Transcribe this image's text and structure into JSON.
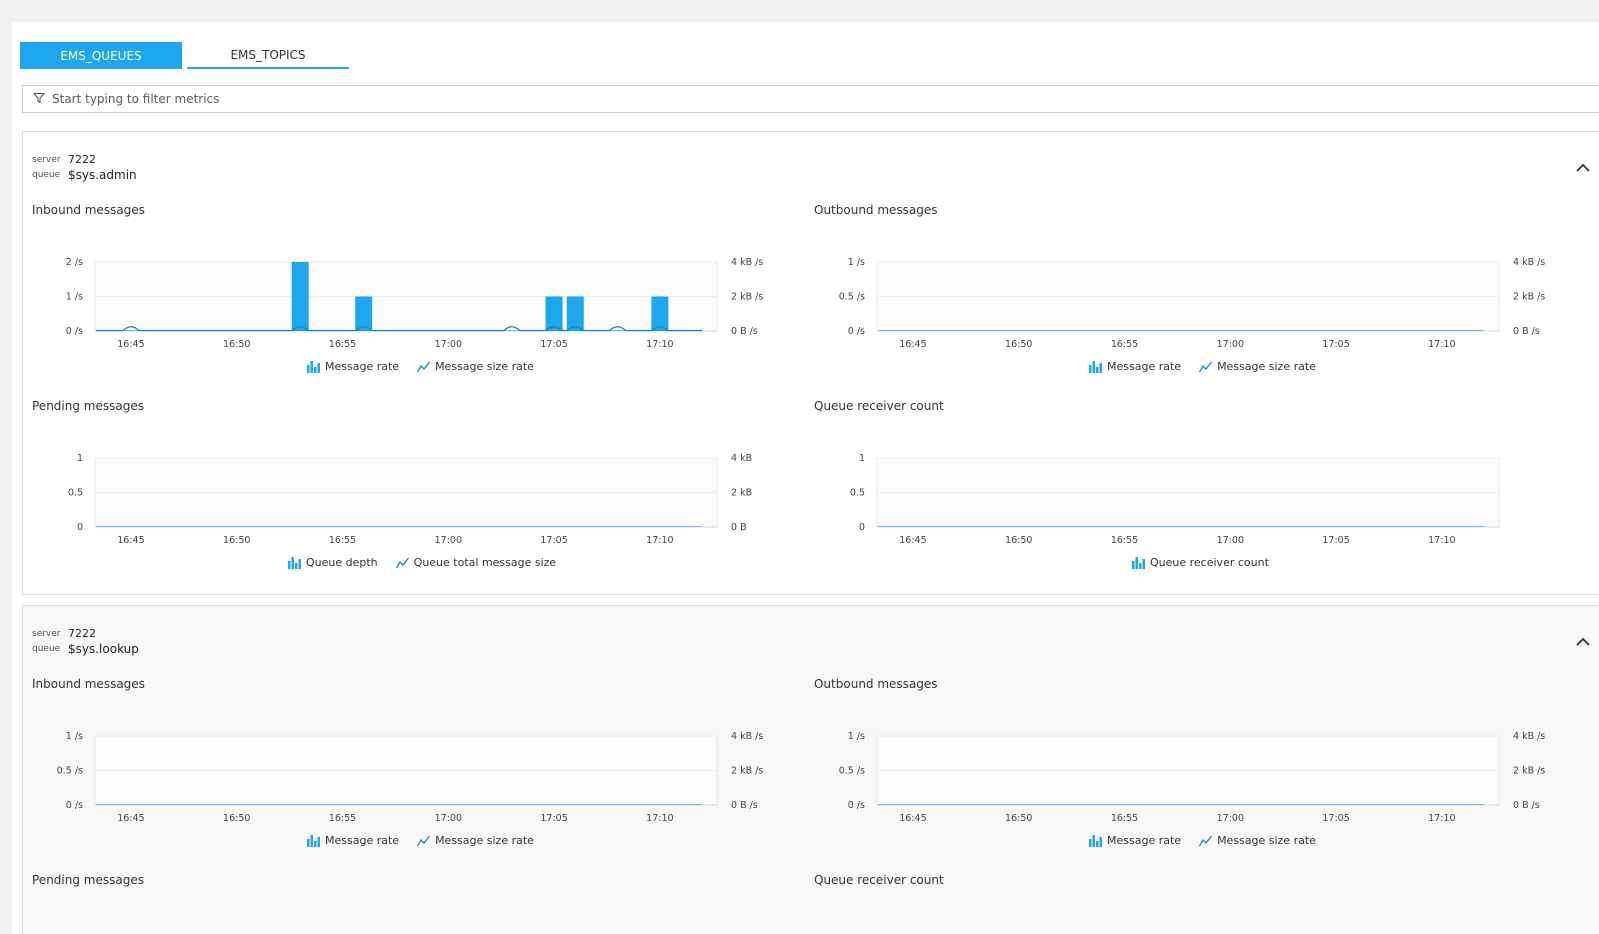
{
  "tabs": [
    {
      "label": "EMS_QUEUES",
      "active": true
    },
    {
      "label": "EMS_TOPICS",
      "active": false
    }
  ],
  "filter": {
    "placeholder": "Start typing to filter metrics",
    "icon": "filter-icon"
  },
  "accent_color": "#1ea7ef",
  "cards": [
    {
      "server_label": "server",
      "server_value": "7222",
      "queue_label": "queue",
      "queue_value": "$sys.admin",
      "collapse_icon": "chevron-up-icon",
      "charts": [
        {
          "title": "Inbound messages",
          "left_ticks": [
            "2 /s",
            "1 /s",
            "0 /s"
          ],
          "right_ticks": [
            "4 kB /s",
            "2 kB /s",
            "0 B /s"
          ],
          "x_ticks": [
            "16:45",
            "16:50",
            "16:55",
            "17:00",
            "17:05",
            "17:10"
          ],
          "legend": [
            {
              "icon": "bar-chart-icon",
              "label": "Message rate"
            },
            {
              "icon": "line-chart-icon",
              "label": "Message size rate"
            }
          ],
          "chart_data": {
            "type": "bar",
            "x": [
              "16:53",
              "16:56",
              "17:05",
              "17:06",
              "17:10"
            ],
            "series": [
              {
                "name": "Message rate",
                "values": [
                  2,
                  1,
                  1,
                  1,
                  1
                ]
              }
            ],
            "ylim": [
              0,
              2
            ]
          }
        },
        {
          "title": "Outbound messages",
          "left_ticks": [
            "1 /s",
            "0.5 /s",
            "0 /s"
          ],
          "right_ticks": [
            "4 kB /s",
            "2 kB /s",
            "0 B /s"
          ],
          "x_ticks": [
            "16:45",
            "16:50",
            "16:55",
            "17:00",
            "17:05",
            "17:10"
          ],
          "legend": [
            {
              "icon": "bar-chart-icon",
              "label": "Message rate"
            },
            {
              "icon": "line-chart-icon",
              "label": "Message size rate"
            }
          ],
          "chart_data": {
            "type": "bar",
            "series": [
              {
                "name": "Message rate",
                "values": []
              }
            ],
            "ylim": [
              0,
              1
            ]
          }
        },
        {
          "title": "Pending messages",
          "left_ticks": [
            "1",
            "0.5",
            "0"
          ],
          "right_ticks": [
            "4 kB",
            "2 kB",
            "0 B"
          ],
          "x_ticks": [
            "16:45",
            "16:50",
            "16:55",
            "17:00",
            "17:05",
            "17:10"
          ],
          "legend": [
            {
              "icon": "bar-chart-icon",
              "label": "Queue depth"
            },
            {
              "icon": "line-chart-icon",
              "label": "Queue total message size"
            }
          ],
          "chart_data": {
            "type": "bar",
            "series": [
              {
                "name": "Queue depth",
                "values": []
              }
            ],
            "ylim": [
              0,
              1
            ]
          }
        },
        {
          "title": "Queue receiver count",
          "left_ticks": [
            "1",
            "0.5",
            "0"
          ],
          "right_ticks": [],
          "x_ticks": [
            "16:45",
            "16:50",
            "16:55",
            "17:00",
            "17:05",
            "17:10"
          ],
          "legend": [
            {
              "icon": "bar-chart-icon",
              "label": "Queue receiver count"
            }
          ],
          "chart_data": {
            "type": "bar",
            "series": [
              {
                "name": "Queue receiver count",
                "values": []
              }
            ],
            "ylim": [
              0,
              1
            ]
          }
        }
      ]
    },
    {
      "server_label": "server",
      "server_value": "7222",
      "queue_label": "queue",
      "queue_value": "$sys.lookup",
      "collapse_icon": "chevron-up-icon",
      "charts": [
        {
          "title": "Inbound messages",
          "left_ticks": [
            "1 /s",
            "0.5 /s",
            "0 /s"
          ],
          "right_ticks": [
            "4 kB /s",
            "2 kB /s",
            "0 B /s"
          ],
          "x_ticks": [
            "16:45",
            "16:50",
            "16:55",
            "17:00",
            "17:05",
            "17:10"
          ],
          "legend": [
            {
              "icon": "bar-chart-icon",
              "label": "Message rate"
            },
            {
              "icon": "line-chart-icon",
              "label": "Message size rate"
            }
          ],
          "chart_data": {
            "type": "bar",
            "series": [
              {
                "name": "Message rate",
                "values": []
              }
            ],
            "ylim": [
              0,
              1
            ]
          }
        },
        {
          "title": "Outbound messages",
          "left_ticks": [
            "1 /s",
            "0.5 /s",
            "0 /s"
          ],
          "right_ticks": [
            "4 kB /s",
            "2 kB /s",
            "0 B /s"
          ],
          "x_ticks": [
            "16:45",
            "16:50",
            "16:55",
            "17:00",
            "17:05",
            "17:10"
          ],
          "legend": [
            {
              "icon": "bar-chart-icon",
              "label": "Message rate"
            },
            {
              "icon": "line-chart-icon",
              "label": "Message size rate"
            }
          ],
          "chart_data": {
            "type": "bar",
            "series": [
              {
                "name": "Message rate",
                "values": []
              }
            ],
            "ylim": [
              0,
              1
            ]
          }
        },
        {
          "title": "Pending messages"
        },
        {
          "title": "Queue receiver count"
        }
      ]
    }
  ]
}
